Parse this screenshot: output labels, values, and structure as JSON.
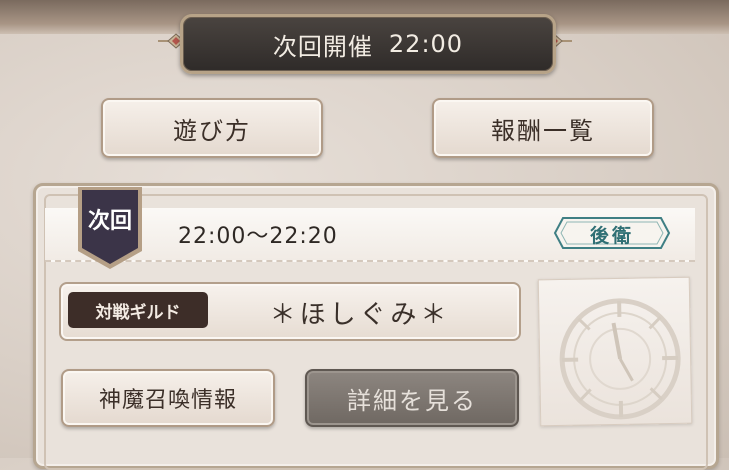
{
  "header": {
    "label": "次回開催",
    "time": "22:00"
  },
  "buttons": {
    "how_to_play": "遊び方",
    "rewards_list": "報酬一覧"
  },
  "match": {
    "tag": "次回",
    "time_range": "22:00〜22:20",
    "role": "後衛",
    "opponent_label": "対戦ギルド",
    "opponent_name": "＊ほしぐみ＊"
  },
  "actions": {
    "summon_info": "神魔召喚情報",
    "view_details": "詳細を見る"
  },
  "colors": {
    "banner": "#2f2b29",
    "tag": "#3b3448",
    "label_bg": "#3d2d28",
    "role": "#2f6f74",
    "disabled_button": "#7b746e"
  },
  "icons": {
    "header_ornaments": "diamond-flourish-icon",
    "clock": "clock-face-icon"
  }
}
